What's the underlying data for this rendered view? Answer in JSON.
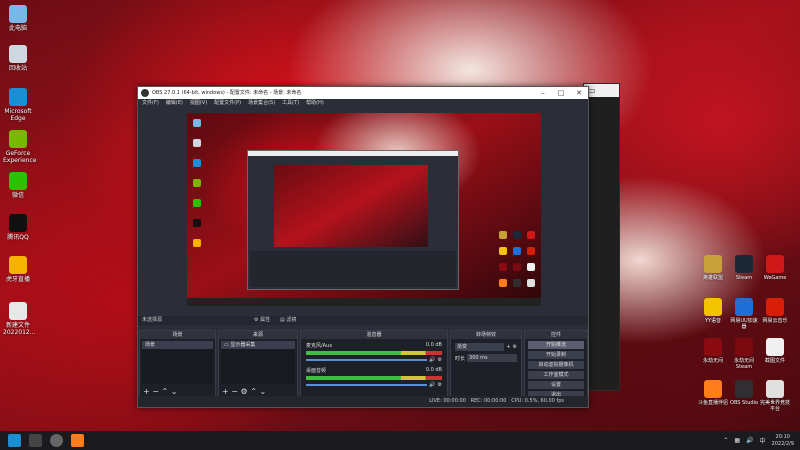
{
  "desktop_left": [
    {
      "label": "此电脑",
      "color": "#7ab7e8"
    },
    {
      "label": "回收站",
      "color": "#cfd8e0"
    },
    {
      "label": "Microsoft Edge",
      "color": "#1b8fd6"
    },
    {
      "label": "GeForce Experience",
      "color": "#76b900"
    },
    {
      "label": "微信",
      "color": "#2dc100"
    },
    {
      "label": "腾讯QQ",
      "color": "#111111"
    },
    {
      "label": "虎牙直播",
      "color": "#f5b300"
    },
    {
      "label": "新建文件 2022012...",
      "color": "#e8e8e8"
    }
  ],
  "desktop_right": [
    {
      "label": "英雄联盟",
      "color": "#c9a13a"
    },
    {
      "label": "Steam",
      "color": "#1b2838"
    },
    {
      "label": "WeGame",
      "color": "#d01818"
    },
    {
      "label": "YY语音",
      "color": "#f5c400"
    },
    {
      "label": "网易UU加速器",
      "color": "#1e6fd8"
    },
    {
      "label": "网易云音乐",
      "color": "#d81e06"
    },
    {
      "label": "永劫无间",
      "color": "#8a0b12"
    },
    {
      "label": "永劫无间 Steam",
      "color": "#7a0a10"
    },
    {
      "label": "截图文件",
      "color": "#f0f0f0"
    },
    {
      "label": "斗鱼直播伴侣",
      "color": "#ff7d1a"
    },
    {
      "label": "OBS Studio",
      "color": "#302e31"
    },
    {
      "label": "完美世界竞技平台",
      "color": "#e0e0e0"
    }
  ],
  "obs": {
    "title": "OBS 27.0.1 (64-bit, windows) - 配置文件: 未命名 - 场景: 未命名",
    "menu": [
      "文件(F)",
      "编辑(E)",
      "视图(V)",
      "配置文件(P)",
      "场景集合(S)",
      "工具(T)",
      "帮助(H)"
    ],
    "source_hint": "未选择源",
    "props_label": "属性",
    "filters_label": "滤镜",
    "docks": {
      "scenes": {
        "title": "场景",
        "items": [
          "场景"
        ]
      },
      "sources": {
        "title": "来源",
        "items": [
          "显示器采集"
        ]
      },
      "mixer": {
        "title": "混音器",
        "ch1": "麦克风/Aux",
        "ch1_db": "0.0 dB",
        "ch2": "桌面音频",
        "ch2_db": "0.0 dB"
      },
      "transitions": {
        "title": "转场特效",
        "type": "渐变",
        "duration_label": "时长",
        "duration": "300 ms"
      },
      "controls": {
        "title": "控件",
        "buttons": [
          "开始推流",
          "开始录制",
          "启动虚拟摄像机",
          "工作室模式",
          "设置",
          "退出"
        ]
      }
    },
    "status": {
      "live": "LIVE: 00:00:00",
      "rec": "REC: 00:00:00",
      "cpu": "CPU: 0.5%, 60.00 fps"
    }
  },
  "taskbar": {
    "time": "20:10",
    "date": "2022/2/9"
  }
}
